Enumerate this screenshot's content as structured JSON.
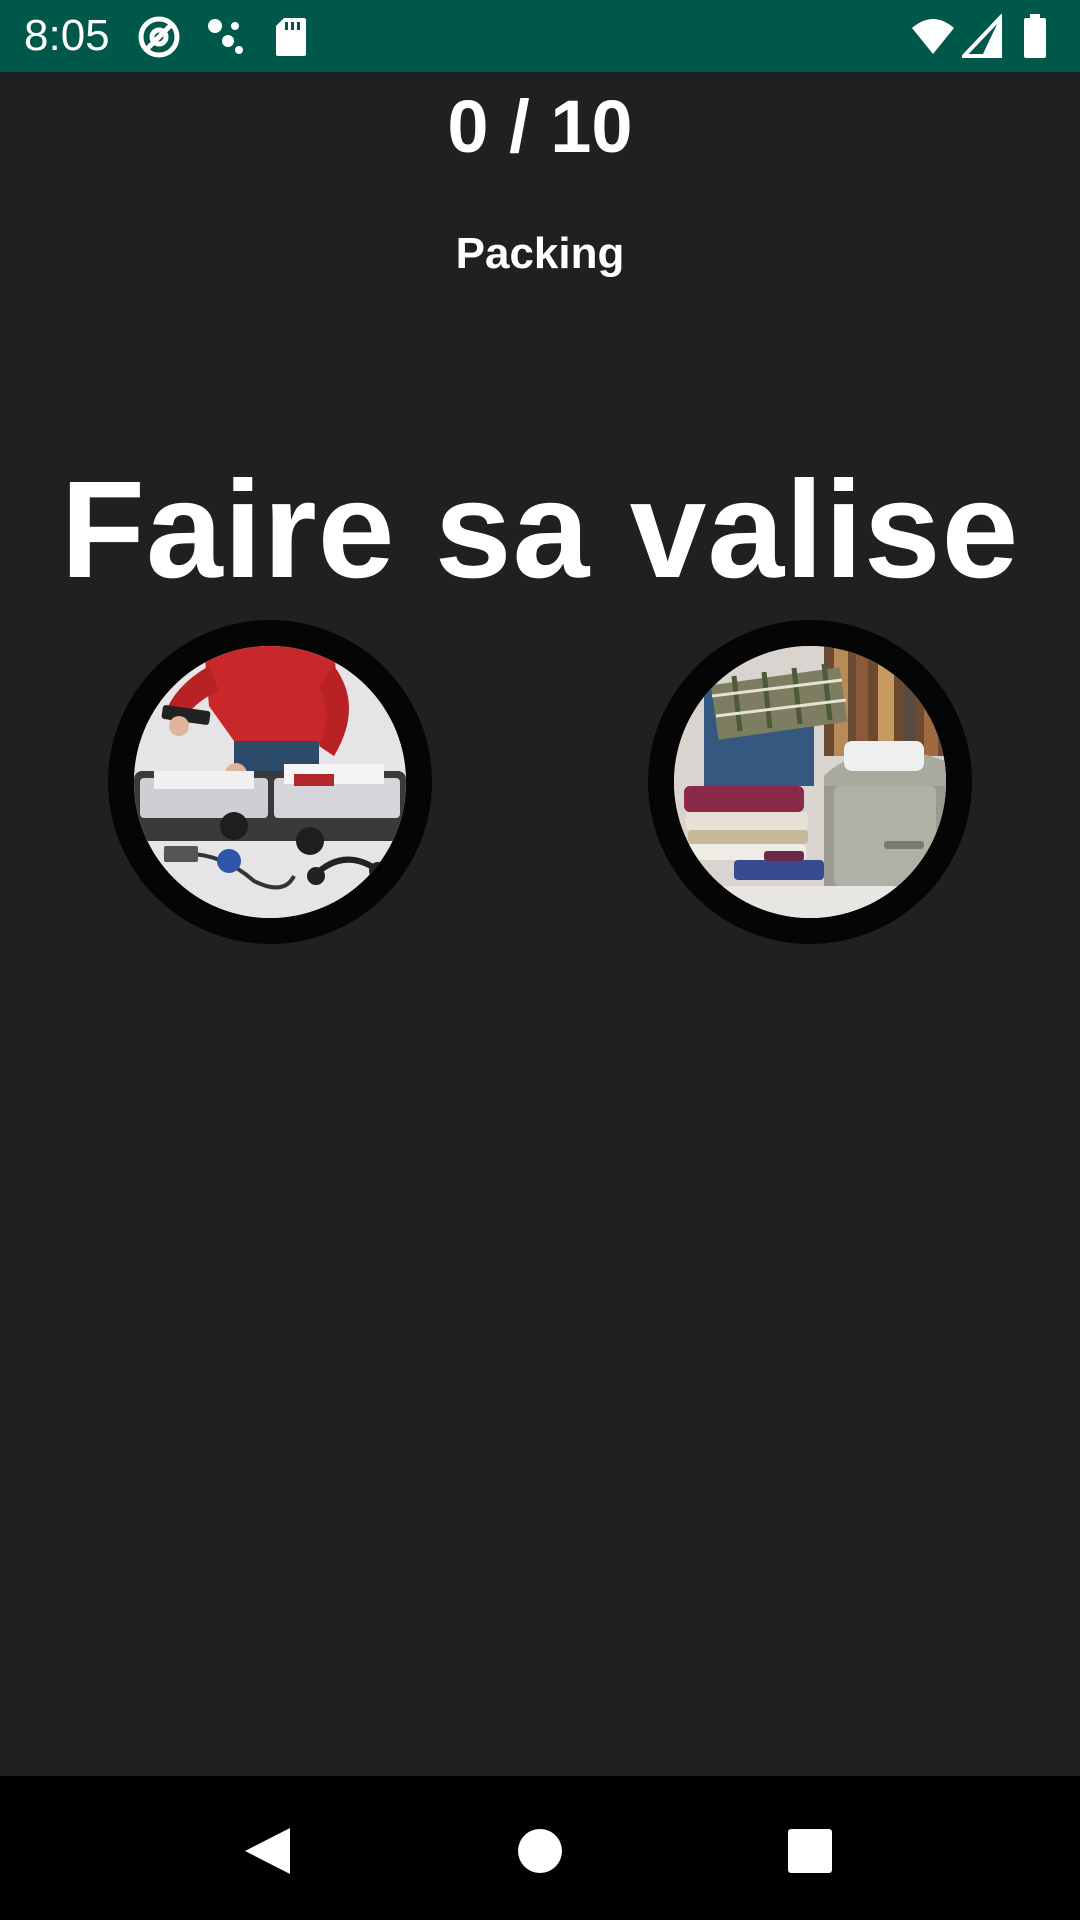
{
  "status_bar": {
    "time": "8:05",
    "left_icons": [
      "at-sign-icon",
      "assistant-dots-icon",
      "sd-card-icon"
    ],
    "right_icons": [
      "wifi-icon",
      "cell-signal-icon",
      "battery-icon"
    ],
    "background": "#00584a"
  },
  "quiz": {
    "progress": "0 / 10",
    "category": "Packing",
    "phrase": "Faire sa valise",
    "options": [
      {
        "image": "person-packing-suitcase-with-electronics-photo"
      },
      {
        "image": "person-folding-clothes-into-suitcase-photo"
      }
    ]
  },
  "nav_bar": {
    "buttons": [
      "back-icon",
      "home-icon",
      "recents-icon"
    ]
  },
  "colors": {
    "background": "#202020",
    "text": "#ffffff",
    "status_bar": "#00584a",
    "nav_bar": "#000000"
  }
}
